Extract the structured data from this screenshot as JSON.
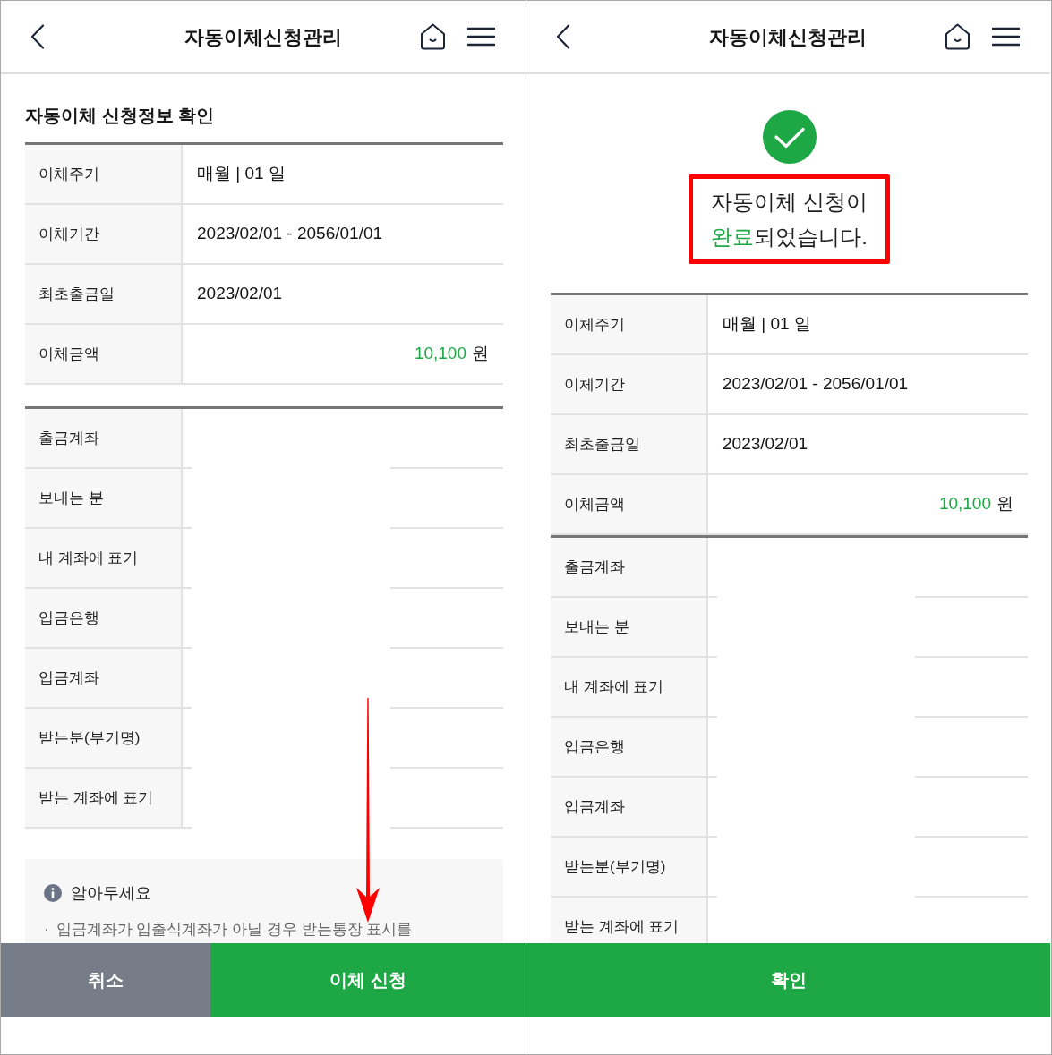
{
  "screens": [
    {
      "header": {
        "title": "자동이체신청관리"
      },
      "section_title": "자동이체 신청정보 확인",
      "pointer_arrow": true,
      "tables": [
        {
          "rows": [
            {
              "label": "이체주기",
              "value": "매월 | 01 일"
            },
            {
              "label": "이체기간",
              "value": "2023/02/01 - 2056/01/01"
            },
            {
              "label": "최초출금일",
              "value": "2023/02/01"
            },
            {
              "label": "이체금액",
              "amount": "10,100",
              "unit": "원"
            }
          ]
        },
        {
          "rows": [
            {
              "label": "출금계좌"
            },
            {
              "label": "보내는 분"
            },
            {
              "label": "내 계좌에 표기"
            },
            {
              "label": "입금은행"
            },
            {
              "label": "입금계좌"
            },
            {
              "label": "받는분(부기명)"
            },
            {
              "label": "받는 계좌에 표기"
            }
          ]
        }
      ],
      "notice": {
        "title": "알아두세요",
        "items": [
          {
            "bullet": "·",
            "text": "입금계좌가 입출식계좌가 아닐 경우 받는통장 표시를"
          }
        ]
      },
      "buttons": [
        {
          "label": "취소",
          "kind": "secondary"
        },
        {
          "label": "이체 신청",
          "kind": "primary"
        }
      ]
    },
    {
      "header": {
        "title": "자동이체신청관리"
      },
      "status": {
        "kind": "success",
        "framed": true,
        "message_lines": [
          [
            {
              "text": "자동이체 신청이",
              "highlight": false
            }
          ],
          [
            {
              "text": "완료",
              "highlight": true
            },
            {
              "text": "되었습니다.",
              "highlight": false
            }
          ]
        ]
      },
      "tables": [
        {
          "rows": [
            {
              "label": "이체주기",
              "value": "매월 | 01 일"
            },
            {
              "label": "이체기간",
              "value": "2023/02/01 - 2056/01/01"
            },
            {
              "label": "최초출금일",
              "value": "2023/02/01"
            },
            {
              "label": "이체금액",
              "amount": "10,100",
              "unit": "원"
            }
          ]
        },
        {
          "rows": [
            {
              "label": "출금계좌"
            },
            {
              "label": "보내는 분"
            },
            {
              "label": "내 계좌에 표기"
            },
            {
              "label": "입금은행"
            },
            {
              "label": "입금계좌"
            },
            {
              "label": "받는분(부기명)"
            },
            {
              "label": "받는 계좌에 표기"
            }
          ]
        }
      ],
      "buttons": [
        {
          "label": "확인",
          "kind": "primary"
        }
      ]
    }
  ]
}
